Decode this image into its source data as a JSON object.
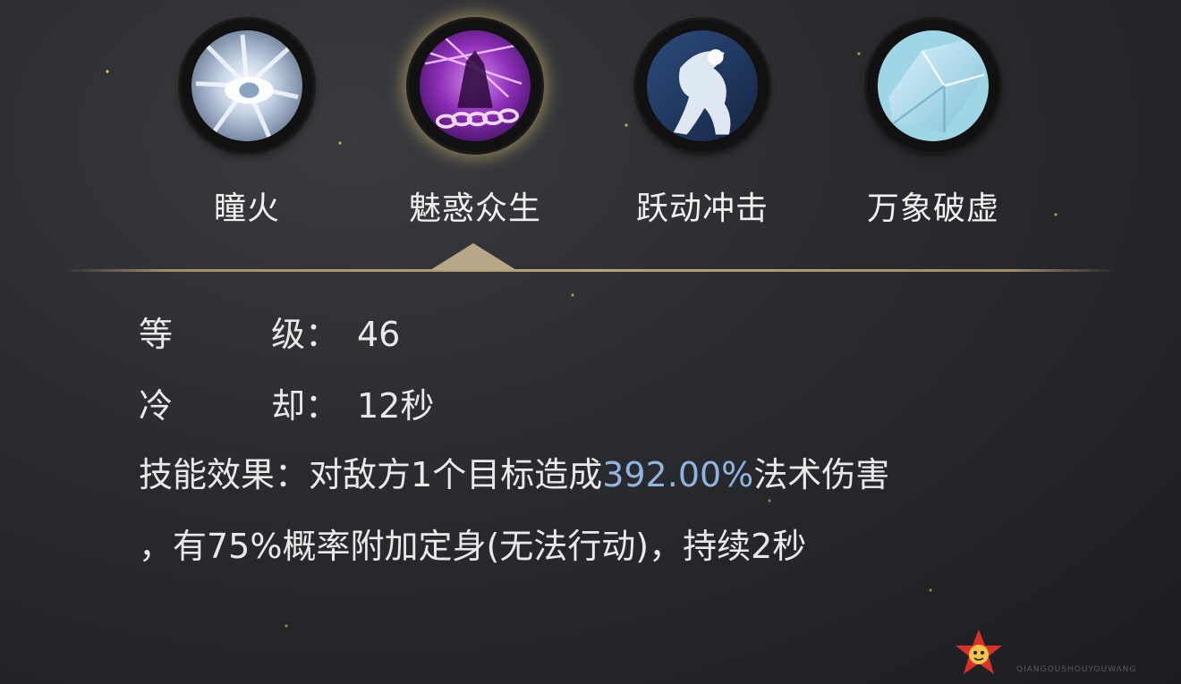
{
  "skills": [
    {
      "name": "瞳火",
      "icon": "white-burst-eye-icon",
      "selected": false
    },
    {
      "name": "魅惑众生",
      "icon": "purple-chain-figure-icon",
      "selected": true
    },
    {
      "name": "跃动冲击",
      "icon": "white-leaping-figure-icon",
      "selected": false
    },
    {
      "name": "万象破虚",
      "icon": "ice-crystal-icon",
      "selected": false
    }
  ],
  "details": {
    "level_label_a": "等",
    "level_label_b": "级：",
    "level_value": "46",
    "cooldown_label_a": "冷",
    "cooldown_label_b": "却：",
    "cooldown_value": "12秒",
    "effect_label": "技能效果：",
    "effect_prefix": "对敌方1个目标造成",
    "effect_highlight": "392.00%",
    "effect_suffix": "法术伤害",
    "effect_line2": "，有75%概率附加定身(无法行动)，持续2秒"
  },
  "colors": {
    "highlight": "#8fb4e2",
    "divider": "#b8a786"
  },
  "watermark": {
    "sub": "QIANGOUSHOUYOUWANG"
  }
}
